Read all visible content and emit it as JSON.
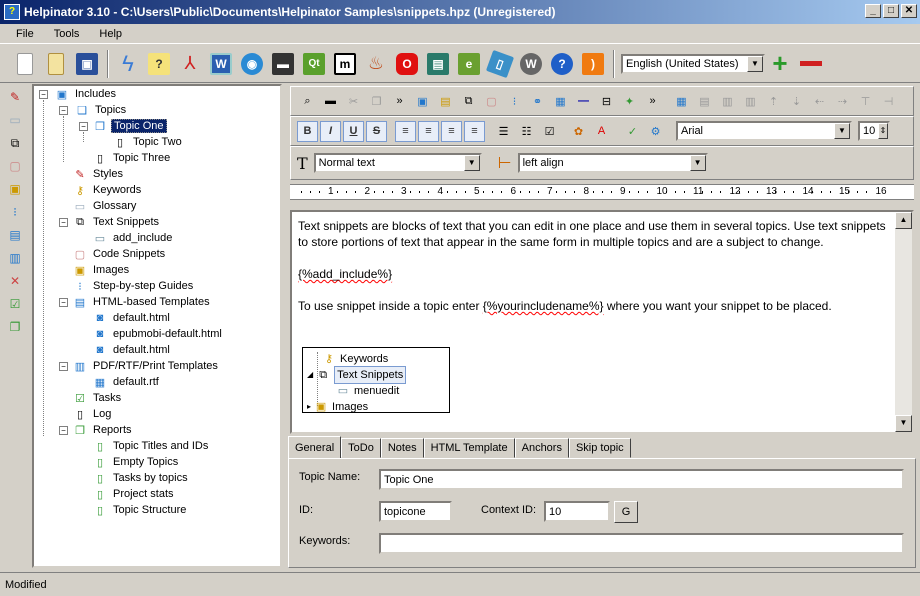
{
  "window": {
    "title": "Helpinator 3.10 - C:\\Users\\Public\\Documents\\Helpinator Samples\\snippets.hpz (Unregistered)"
  },
  "menu": [
    "File",
    "Tools",
    "Help"
  ],
  "language_select": {
    "value": "English (United States)"
  },
  "tree": {
    "root": "Includes",
    "topics": "Topics",
    "topic_one": "Topic One",
    "topic_two": "Topic Two",
    "topic_three": "Topic Three",
    "styles": "Styles",
    "keywords": "Keywords",
    "glossary": "Glossary",
    "text_snippets": "Text Snippets",
    "add_include": "add_include",
    "code_snippets": "Code Snippets",
    "images": "Images",
    "step_guides": "Step-by-step Guides",
    "html_templates": "HTML-based Templates",
    "default_html_1": "default.html",
    "epubmobi": "epubmobi-default.html",
    "default_html_2": "default.html",
    "pdf_templates": "PDF/RTF/Print Templates",
    "default_rtf": "default.rtf",
    "tasks": "Tasks",
    "log": "Log",
    "reports": "Reports",
    "topic_titles": "Topic Titles and IDs",
    "empty_topics": "Empty Topics",
    "tasks_by_topics": "Tasks by topics",
    "project_stats": "Project stats",
    "topic_structure": "Topic Structure"
  },
  "format": {
    "font": "Arial",
    "size": "10",
    "style": "Normal text",
    "align": "left align"
  },
  "ruler_marks": [
    "1",
    "2",
    "3",
    "4",
    "5",
    "6",
    "7",
    "8",
    "9",
    "10",
    "11",
    "12",
    "13",
    "14",
    "15",
    "16"
  ],
  "editor": {
    "para1": "Text snippets are blocks of text that you can edit in one place and use them in several topics. Use text snippets to store portions of text that appear in the same form in multiple topics and are a subject to change.",
    "snippet": "{%add_include%}",
    "para3_before": "To use snippet inside a topic enter ",
    "para3_code": "{%yourincludename%}",
    "para3_after": " where you want your snippet to be placed.",
    "minitree": {
      "keywords": "Keywords",
      "text_snippets": "Text Snippets",
      "menuedit": "menuedit",
      "images": "Images"
    }
  },
  "tabs": [
    "General",
    "ToDo",
    "Notes",
    "HTML Template",
    "Anchors",
    "Skip topic"
  ],
  "props": {
    "topic_name_label": "Topic Name:",
    "topic_name": "Topic One",
    "id_label": "ID:",
    "id": "topicone",
    "context_id_label": "Context ID:",
    "context_id": "10",
    "g_button": "G",
    "keywords_label": "Keywords:",
    "keywords": ""
  },
  "status": "Modified"
}
